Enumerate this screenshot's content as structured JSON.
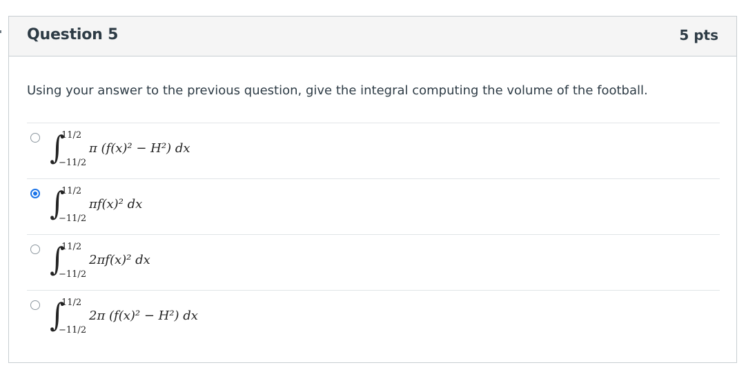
{
  "question": {
    "title": "Question 5",
    "points": "5 pts",
    "prompt": "Using your answer to the previous question, give the integral computing the volume of the football."
  },
  "answers": [
    {
      "upper": "11/2",
      "lower": "−11/2",
      "integrand": "π (f(x)² − H²) dx",
      "selected": false
    },
    {
      "upper": "11/2",
      "lower": "−11/2",
      "integrand": "πf(x)² dx",
      "selected": true
    },
    {
      "upper": "11/2",
      "lower": "−11/2",
      "integrand": "2πf(x)² dx",
      "selected": false
    },
    {
      "upper": "11/2",
      "lower": "−11/2",
      "integrand": "2π (f(x)² − H²) dx",
      "selected": false
    }
  ],
  "colors": {
    "accent": "#1a73e8",
    "border": "#c7cdd1",
    "header_bg": "#f5f5f5",
    "text": "#2d3b45"
  },
  "icons": {
    "radio": "radio-button-icon",
    "integral": "integral-sign-icon"
  }
}
